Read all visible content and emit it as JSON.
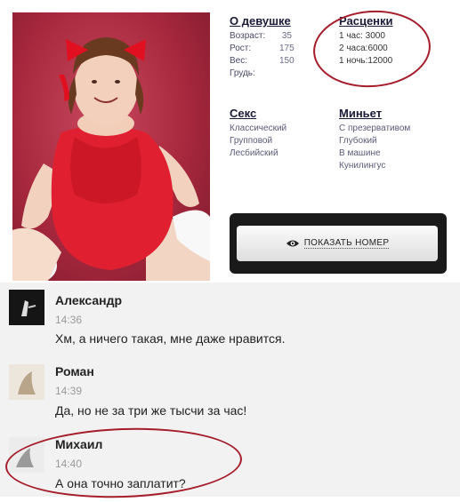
{
  "profile": {
    "about": {
      "heading": "О девушке",
      "fields": [
        {
          "label": "Возраст:",
          "value": "35"
        },
        {
          "label": "Рост:",
          "value": "175"
        },
        {
          "label": "Вес:",
          "value": "150"
        },
        {
          "label": "Грудь:",
          "value": ""
        }
      ]
    },
    "prices": {
      "heading": "Расценки",
      "items": [
        {
          "label": "1 час:",
          "value": "3000"
        },
        {
          "label": "2 часа:",
          "value": "6000"
        },
        {
          "label": "1 ночь:",
          "value": "12000"
        }
      ]
    },
    "services_a": {
      "heading": "Секс",
      "items": [
        "Классический",
        "Групповой",
        "Лесбийский"
      ]
    },
    "services_b": {
      "heading": "Миньет",
      "items": [
        "С презервативом",
        "Глубокий",
        "В машине",
        "Кунилингус"
      ]
    },
    "show_number_label": "ПОКАЗАТЬ НОМЕР",
    "show_number_icon": "eye-icon"
  },
  "comments": [
    {
      "author": "Александр",
      "time": "14:36",
      "text": "Хм, а ничего такая, мне даже нравится."
    },
    {
      "author": "Роман",
      "time": "14:39",
      "text": "Да, но не за три же тысчи за час!"
    },
    {
      "author": "Михаил",
      "time": "14:40",
      "text": "А она точно заплатит?"
    }
  ],
  "colors": {
    "annotation_circle": "#a51c2a",
    "photo_background": "#a8283e",
    "dress": "#e02030",
    "chat_background": "#f2f2f2"
  }
}
